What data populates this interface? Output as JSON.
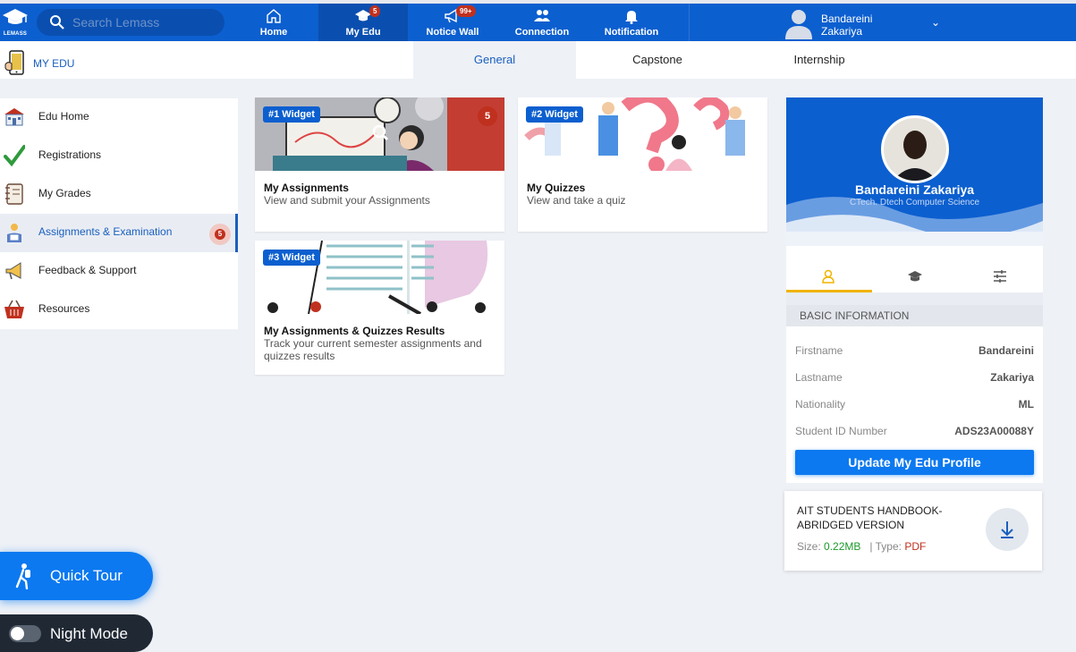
{
  "app": {
    "logo_text": "LEMASS"
  },
  "search": {
    "placeholder": "Search Lemass"
  },
  "nav": [
    {
      "label": "Home",
      "icon": "home-icon"
    },
    {
      "label": "My Edu",
      "icon": "graduation-cap-icon",
      "badge": "5"
    },
    {
      "label": "Notice Wall",
      "icon": "megaphone-icon",
      "badge": "99+"
    },
    {
      "label": "Connection",
      "icon": "people-icon"
    },
    {
      "label": "Notification",
      "icon": "bell-icon"
    }
  ],
  "user": {
    "first": "Bandareini",
    "last": "Zakariya"
  },
  "subnav": {
    "section_label": "MY EDU",
    "tabs": [
      "General",
      "Capstone",
      "Internship"
    ]
  },
  "sidebar": {
    "items": [
      {
        "label": "Edu Home",
        "icon": "school-icon"
      },
      {
        "label": "Registrations",
        "icon": "checkmark-icon"
      },
      {
        "label": "My Grades",
        "icon": "notebook-icon"
      },
      {
        "label": "Assignments & Examination",
        "icon": "reading-student-icon",
        "badge": "5"
      },
      {
        "label": "Feedback & Support",
        "icon": "megaphone-icon"
      },
      {
        "label": "Resources",
        "icon": "basket-icon"
      }
    ]
  },
  "widgets": [
    {
      "tag": "#1 Widget",
      "title": "My Assignments",
      "desc": "View and submit your Assignments",
      "badge": "5"
    },
    {
      "tag": "#2 Widget",
      "title": "My Quizzes",
      "desc": "View and take a quiz"
    },
    {
      "tag": "#3 Widget",
      "title": "My Assignments & Quizzes Results",
      "desc": "Track your current semester assignments and quizzes results"
    }
  ],
  "profile": {
    "name": "Bandareini Zakariya",
    "program": "CTech. Dtech Computer Science",
    "section_title": "BASIC INFORMATION",
    "fields": [
      {
        "key": "Firstname",
        "value": "Bandareini"
      },
      {
        "key": "Lastname",
        "value": "Zakariya"
      },
      {
        "key": "Nationality",
        "value": "ML"
      },
      {
        "key": "Student ID Number",
        "value": "ADS23A00088Y"
      }
    ],
    "update_label": "Update My Edu Profile"
  },
  "handbook": {
    "title": "AIT STUDENTS HANDBOOK-ABRIDGED VERSION",
    "size_label": "Size:",
    "size": "0.22MB",
    "type_label": "| Type:",
    "type": "PDF"
  },
  "floating": {
    "quick_tour": "Quick Tour",
    "night_mode": "Night Mode"
  },
  "colors": {
    "primary": "#0c5fcf",
    "accent_button": "#0c79f0",
    "badge": "#c0301e",
    "active_tab_underline": "#f0b400"
  }
}
